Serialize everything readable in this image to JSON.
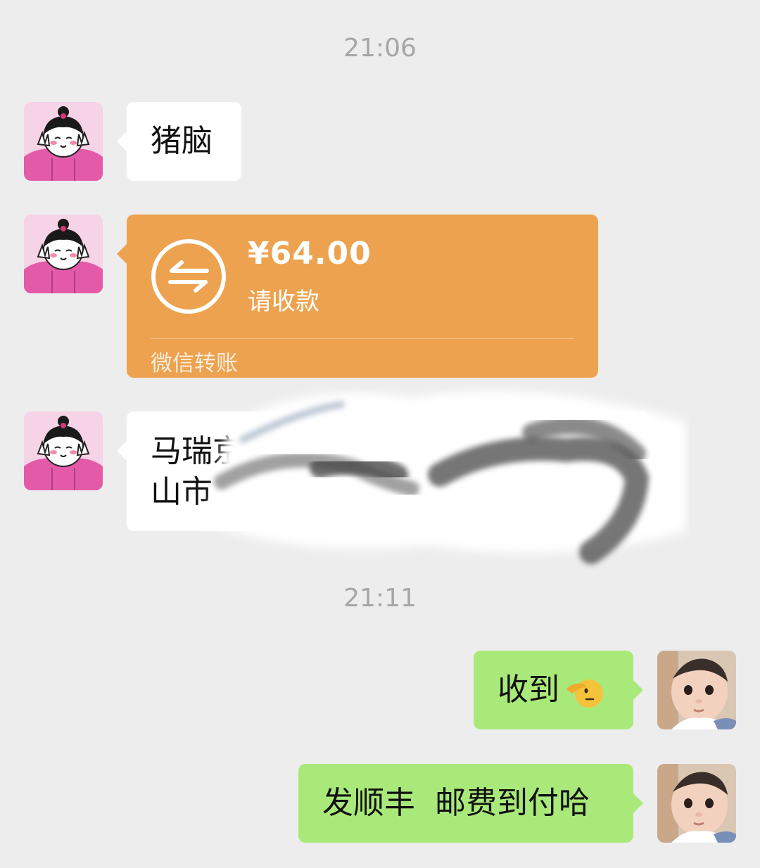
{
  "timestamps": [
    "21:06",
    "21:11"
  ],
  "messages": {
    "msg1": {
      "text": "猪脑"
    },
    "transfer": {
      "amount": "¥64.00",
      "status": "请收款",
      "footer": "微信转账",
      "icon": "transfer-arrows-icon",
      "color": "#EDA24F"
    },
    "msg3": {
      "line1": "马瑞京",
      "line2": "山市"
    },
    "msg4": {
      "text": "收到",
      "emoji": "saluting-face-emoji"
    },
    "msg5": {
      "text": "发顺丰  邮费到付哈"
    }
  },
  "colors": {
    "background": "#EDEDED",
    "incoming_bubble": "#FFFFFF",
    "outgoing_bubble": "#A9E97A",
    "timestamp_text": "#A6A6A6"
  }
}
